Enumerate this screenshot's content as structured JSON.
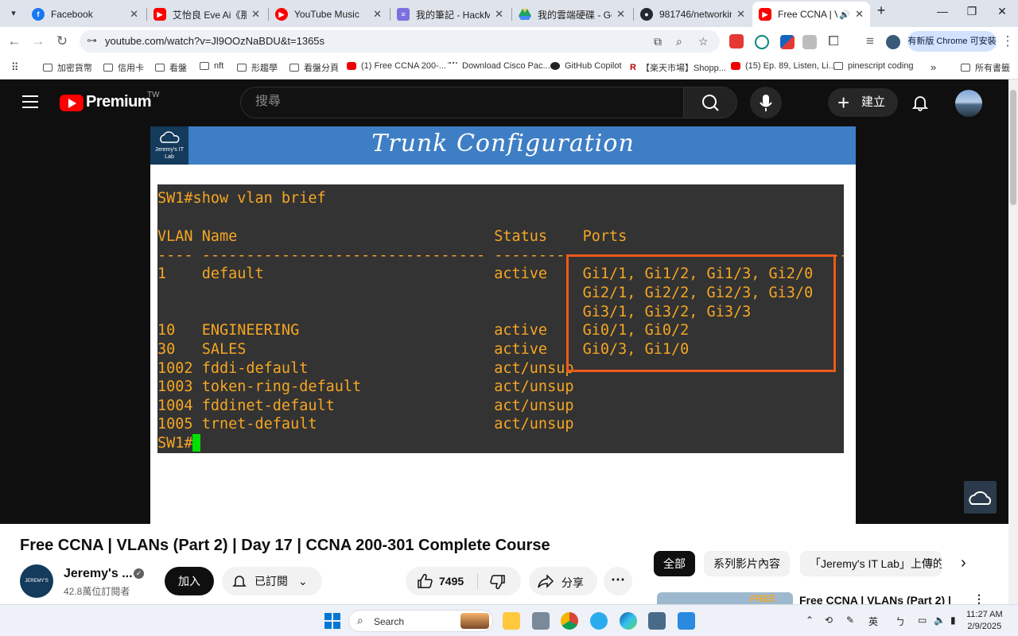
{
  "browser": {
    "tabs": [
      {
        "title": "Facebook",
        "favicon": "facebook-icon",
        "color": "#1877f2"
      },
      {
        "title": "艾怡良 Eve Ai《那時",
        "favicon": "youtube-icon",
        "color": "#ff0000"
      },
      {
        "title": "YouTube Music",
        "favicon": "youtube-music-icon",
        "color": "#ff0000"
      },
      {
        "title": "我的筆記 - HackMD",
        "favicon": "hackmd-icon",
        "color": "#7c6fe0"
      },
      {
        "title": "我的雲端硬碟 - Goog",
        "favicon": "google-drive-icon",
        "color": "#1fa463"
      },
      {
        "title": "981746/networking-",
        "favicon": "github-icon",
        "color": "#24292f"
      },
      {
        "title": "Free CCNA | VLAN",
        "favicon": "youtube-icon",
        "color": "#ff0000"
      }
    ],
    "new_tab": "+",
    "url": "youtube.com/watch?v=Jl9OOzNaBDU&t=1365s",
    "update_label": "有新版 Chrome 可安裝",
    "bookmarks": [
      "加密貨幣",
      "信用卡",
      "看盤",
      "nft",
      "形趨學",
      "看盤分頁",
      "(1) Free CCNA 200-...",
      "Download Cisco Pac...",
      "GitHub Copilot",
      "【楽天市場】Shopp...",
      "(15) Ep. 89, Listen, Li...",
      "pinescript coding"
    ],
    "bookmarks_more": "»",
    "bookmarks_all": "所有書籤"
  },
  "youtube": {
    "brand": "Premium",
    "region": "TW",
    "search_placeholder": "搜尋",
    "create_label": "建立"
  },
  "slide": {
    "logo_text": "Jeremy's IT Lab",
    "title": "Trunk Configuration",
    "terminal_lines": [
      "SW1#show vlan brief",
      "",
      "VLAN Name                             Status    Ports",
      "---- -------------------------------- --------- -------------------------------",
      "1    default                          active    Gi1/1, Gi1/2, Gi1/3, Gi2/0",
      "                                                Gi2/1, Gi2/2, Gi2/3, Gi3/0",
      "                                                Gi3/1, Gi3/2, Gi3/3",
      "10   ENGINEERING                      active    Gi0/1, Gi0/2",
      "30   SALES                            active    Gi0/3, Gi1/0",
      "1002 fddi-default                     act/unsup",
      "1003 token-ring-default               act/unsup",
      "1004 fddinet-default                  act/unsup",
      "1005 trnet-default                    act/unsup",
      "SW1#"
    ],
    "text_color": "#f5a623",
    "highlight_color": "#ee5a1a"
  },
  "video": {
    "title": "Free CCNA | VLANs (Part 2) | Day 17 | CCNA 200-301 Complete Course",
    "channel": "Jeremy's ...",
    "subscribers": "42.8萬位訂閱者",
    "join_label": "加入",
    "subscribed_label": "已訂閱",
    "likes": "7495",
    "share_label": "分享"
  },
  "sidebar": {
    "chips": [
      "全部",
      "系列影片內容",
      "「Jeremy's IT Lab」上傳的"
    ],
    "related_title": "Free CCNA | VLANs (Part 2) |",
    "related_thumb_label": "FREE"
  },
  "taskbar": {
    "search_label": "Search",
    "ime_label": "英",
    "time": "11:27 AM",
    "date": "2/9/2025"
  }
}
